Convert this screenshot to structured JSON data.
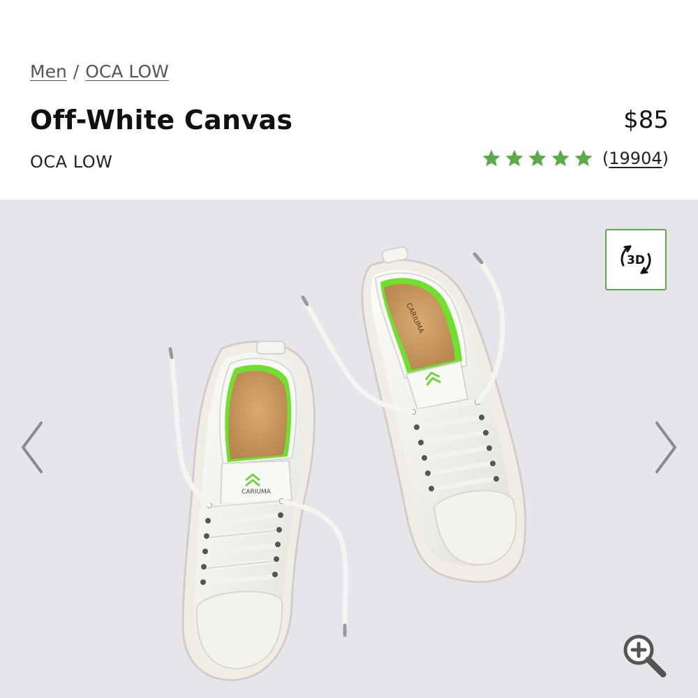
{
  "breadcrumb": {
    "items": [
      {
        "label": "Men"
      },
      {
        "label": "OCA LOW"
      }
    ],
    "separator": "/"
  },
  "product": {
    "title": "Off-White Canvas",
    "model": "OCA LOW",
    "price": "$85",
    "rating": {
      "stars": 5,
      "reviews_open": "(",
      "reviews_count": "19904",
      "reviews_close": ")"
    }
  },
  "gallery": {
    "button_3d_label": "3D",
    "brand_print": "CARIUMA",
    "icons": {
      "prev": "chevron-left-icon",
      "next": "chevron-right-icon",
      "view_3d": "rotate-3d-icon",
      "zoom": "zoom-in-icon"
    }
  },
  "colors": {
    "star": "#5aab45",
    "border_3d": "#5aab45",
    "gallery_bg": "#e6e6ea",
    "insole_accent": "#6ee02d",
    "cork": "#c99a62"
  }
}
